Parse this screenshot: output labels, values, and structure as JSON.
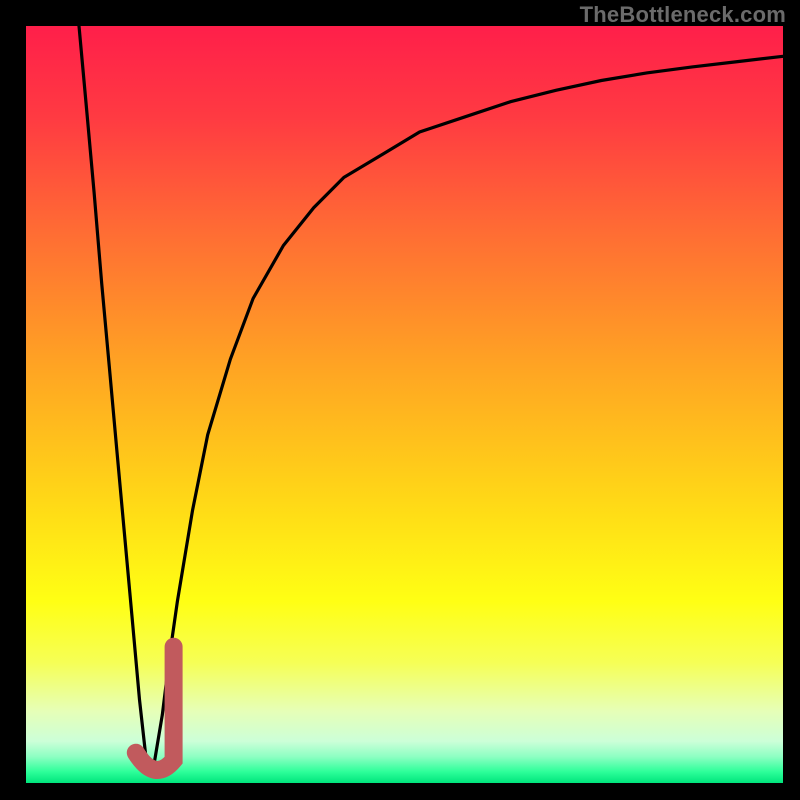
{
  "watermark": "TheBottleneck.com",
  "colors": {
    "bg": "#000000",
    "curve": "#000000",
    "marker": "#c15a5d",
    "gradient_stops": [
      {
        "offset": 0.0,
        "color": "#ff1f4a"
      },
      {
        "offset": 0.12,
        "color": "#ff3a42"
      },
      {
        "offset": 0.28,
        "color": "#ff6f33"
      },
      {
        "offset": 0.45,
        "color": "#ffa423"
      },
      {
        "offset": 0.62,
        "color": "#ffd617"
      },
      {
        "offset": 0.76,
        "color": "#ffff14"
      },
      {
        "offset": 0.84,
        "color": "#f6ff55"
      },
      {
        "offset": 0.905,
        "color": "#e6ffb7"
      },
      {
        "offset": 0.945,
        "color": "#ccffd8"
      },
      {
        "offset": 0.965,
        "color": "#8effc3"
      },
      {
        "offset": 0.985,
        "color": "#2eff9a"
      },
      {
        "offset": 1.0,
        "color": "#00e57c"
      }
    ]
  },
  "chart_data": {
    "type": "line",
    "title": "",
    "xlabel": "",
    "ylabel": "",
    "xlim": [
      0,
      100
    ],
    "ylim": [
      0,
      100
    ],
    "x": [
      7,
      8,
      9,
      10,
      11,
      12,
      13,
      14,
      15,
      16,
      17,
      18,
      19,
      20,
      22,
      24,
      27,
      30,
      34,
      38,
      42,
      47,
      52,
      58,
      64,
      70,
      76,
      82,
      88,
      94,
      100
    ],
    "values": [
      100,
      89,
      78,
      66,
      55,
      44,
      33,
      22,
      11,
      2,
      3,
      9,
      17,
      24,
      36,
      46,
      56,
      64,
      71,
      76,
      80,
      83,
      86,
      88,
      90,
      91.5,
      92.8,
      93.8,
      94.6,
      95.3,
      96
    ],
    "marker": {
      "shape": "J",
      "x_range": [
        14.5,
        19.5
      ],
      "y_range": [
        0,
        18
      ]
    },
    "note": "Values are percent-of-plot-height (0=bottom green, 100=top red). Curve is a V-shaped dip to ~x=16 then asymptotically rises toward top-right."
  }
}
